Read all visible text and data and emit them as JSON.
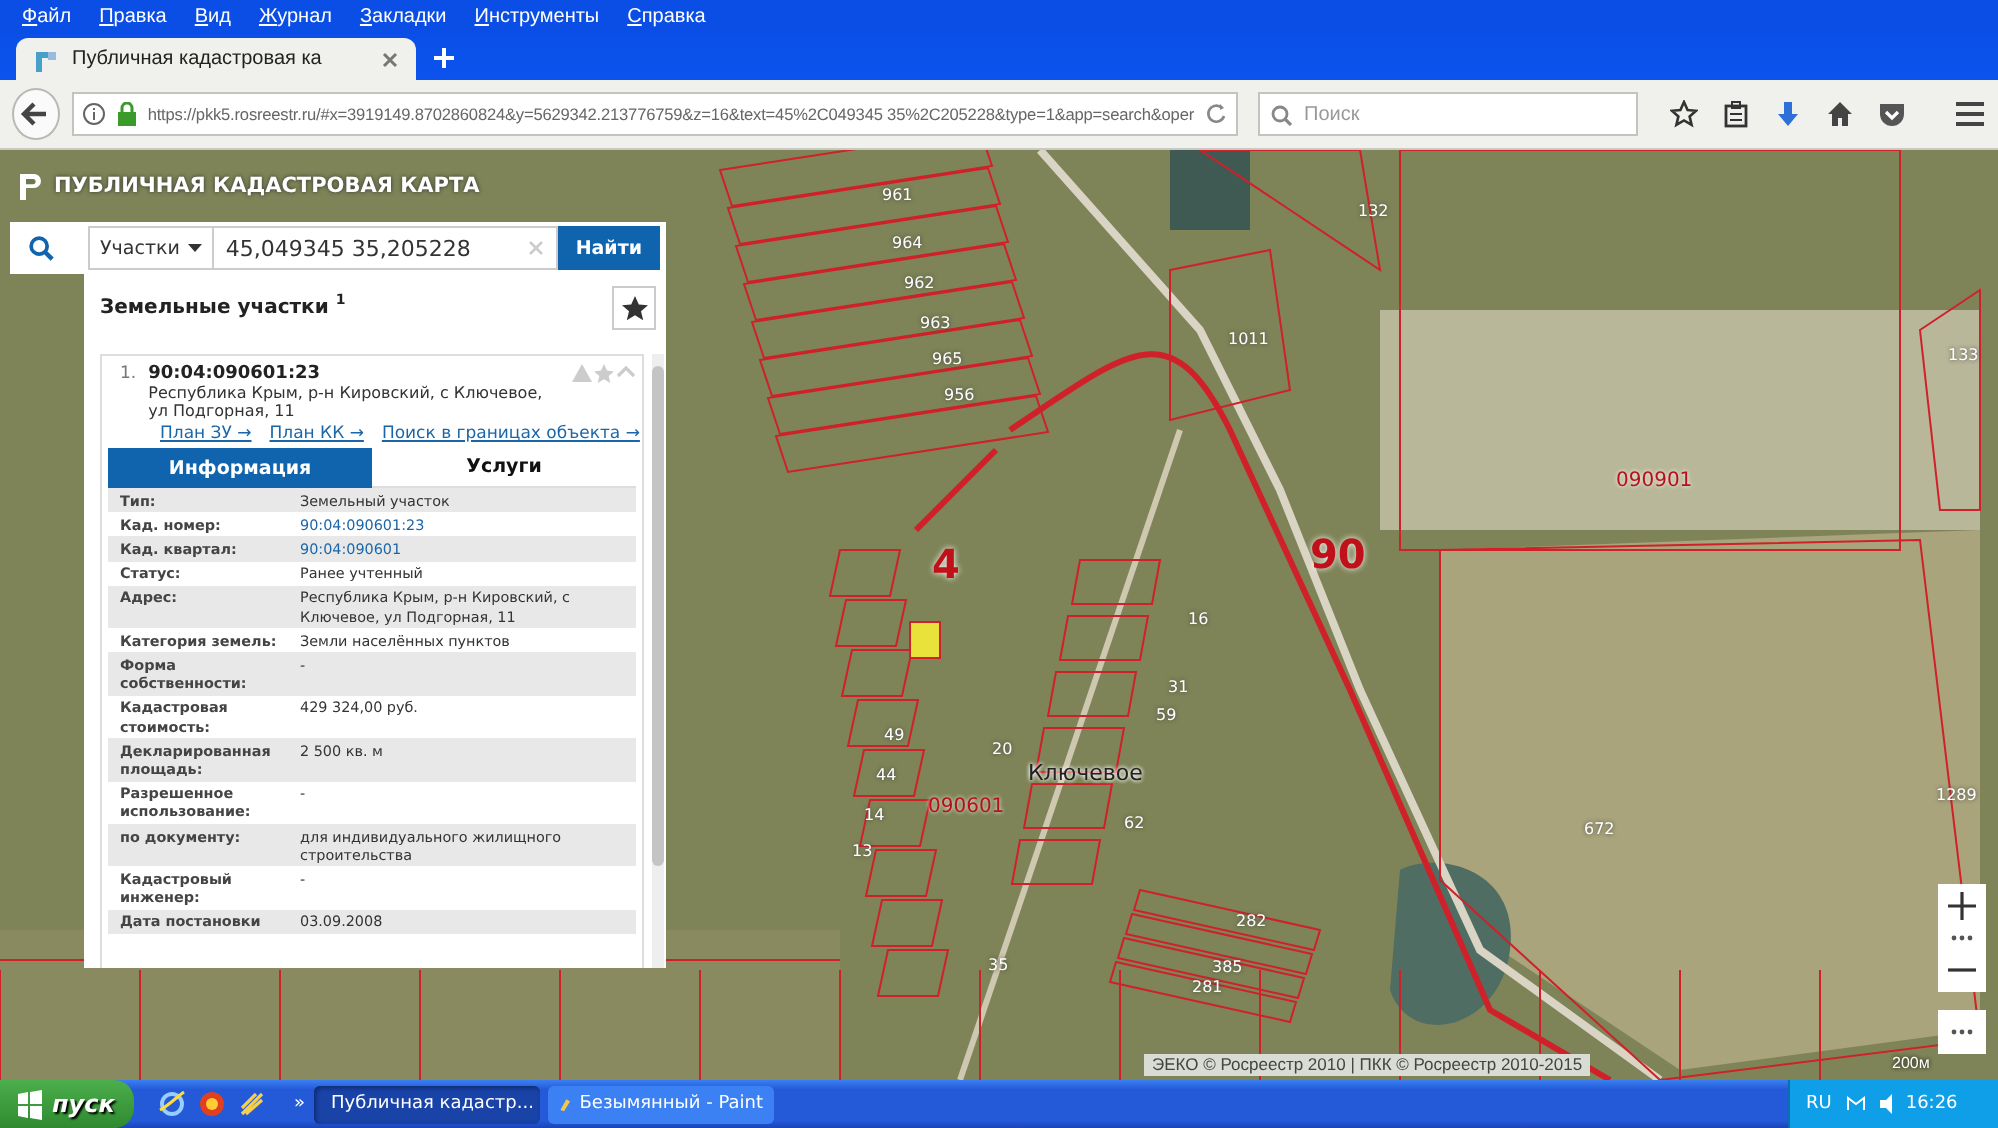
{
  "browser": {
    "menu": [
      "Файл",
      "Правка",
      "Вид",
      "Журнал",
      "Закладки",
      "Инструменты",
      "Справка"
    ],
    "tabs": [
      {
        "label": "Публичная кадастровая ка",
        "selected": true
      }
    ],
    "address_bar": {
      "url": "https://pkk5.rosreestr.ru/#x=3919149.8702860824&y=5629342.213776759&z=16&text=45%2C049345 35%2C205228&type=1&app=search&oper"
    },
    "search_field": {
      "placeholder": "Поиск"
    }
  },
  "app": {
    "title": "ПУБЛИЧНАЯ КАДАСТРОВАЯ КАРТА",
    "search": {
      "category": "Участки",
      "query": "45,049345 35,205228",
      "button": "Найти"
    },
    "results": {
      "heading": "Земельные участки $^{1}$",
      "item": {
        "number": "1.",
        "cadastral_number": "90:04:090601:23",
        "address": "Республика Крым, р-н Кировский, с Ключевое, ул Подгорная, 11",
        "links": [
          "План ЗУ →",
          "План КК →",
          "Поиск в границах объекта →"
        ],
        "detail_tabs": [
          {
            "label": "Информация",
            "selected": true
          },
          {
            "label": "Услуги",
            "selected": false
          }
        ],
        "fields": [
          {
            "label": "Тип:",
            "value": "Земельный участок",
            "kind": "text"
          },
          {
            "label": "Кад. номер:",
            "value": "90:04:090601:23",
            "kind": "link"
          },
          {
            "label": "Кад. квартал:",
            "value": "90:04:090601",
            "kind": "link"
          },
          {
            "label": "Статус:",
            "value": "Ранее учтенный",
            "kind": "text"
          },
          {
            "label": "Адрес:",
            "value": "Республика Крым, р-н Кировский, с Ключевое, ул Подгорная, 11",
            "kind": "text"
          },
          {
            "label": "Категория земель:",
            "value": "Земли населённых пунктов",
            "kind": "text"
          },
          {
            "label": "Форма собственности:",
            "value": "-",
            "kind": "text"
          },
          {
            "label": "Кадастровая стоимость:",
            "value": "429 324,00 руб.",
            "kind": "text"
          },
          {
            "label": "Декларированная площадь:",
            "value": "2 500 кв. м",
            "kind": "text"
          },
          {
            "label": "Разрешенное использование:",
            "value": "-",
            "kind": "text"
          },
          {
            "label": "по документу:",
            "value": "для индивидуального жилищного строительства",
            "kind": "text"
          },
          {
            "label": "Кадастровый инженер:",
            "value": "-",
            "kind": "text"
          },
          {
            "label": "Дата постановки",
            "value": "03.09.2008",
            "kind": "text"
          }
        ]
      }
    }
  },
  "map": {
    "labels": [
      {
        "text": "961",
        "kind": "parcel"
      },
      {
        "text": "964",
        "kind": "parcel"
      },
      {
        "text": "962",
        "kind": "parcel"
      },
      {
        "text": "963",
        "kind": "parcel"
      },
      {
        "text": "965",
        "kind": "parcel"
      },
      {
        "text": "956",
        "kind": "parcel"
      },
      {
        "text": "132",
        "kind": "parcel"
      },
      {
        "text": "1011",
        "kind": "parcel"
      },
      {
        "text": "133",
        "kind": "parcel"
      },
      {
        "text": "90",
        "kind": "district"
      },
      {
        "text": "090901",
        "kind": "quarter"
      },
      {
        "text": "4",
        "kind": "district"
      },
      {
        "text": "090601",
        "kind": "quarter"
      },
      {
        "text": "Ключевое",
        "kind": "place"
      },
      {
        "text": "672",
        "kind": "parcel"
      },
      {
        "text": "1289",
        "kind": "parcel"
      },
      {
        "text": "49",
        "kind": "parcel"
      },
      {
        "text": "14",
        "kind": "parcel"
      },
      {
        "text": "13",
        "kind": "parcel"
      },
      {
        "text": "44",
        "kind": "parcel"
      },
      {
        "text": "20",
        "kind": "parcel"
      },
      {
        "text": "62",
        "kind": "parcel"
      },
      {
        "text": "16",
        "kind": "parcel"
      },
      {
        "text": "31",
        "kind": "parcel"
      },
      {
        "text": "59",
        "kind": "parcel"
      },
      {
        "text": "282",
        "kind": "parcel"
      },
      {
        "text": "385",
        "kind": "parcel"
      },
      {
        "text": "281",
        "kind": "parcel"
      },
      {
        "text": "35",
        "kind": "parcel"
      }
    ],
    "attribution": "ЭЕКО © Росреестр 2010 | ПКК © Росреестр 2010-2015",
    "scale": "200м"
  },
  "taskbar": {
    "start": "пуск",
    "overflow": "»",
    "windows": [
      {
        "label": "Публичная кадастр...",
        "selected": true
      },
      {
        "label": "Безымянный - Paint",
        "selected": false
      }
    ],
    "language": "RU",
    "clock": "16:26"
  }
}
